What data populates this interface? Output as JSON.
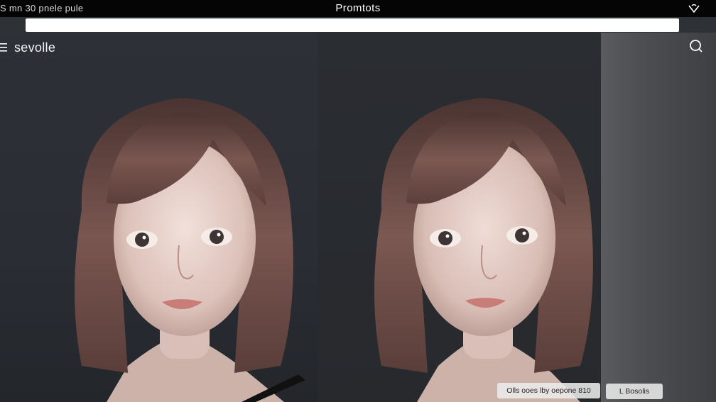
{
  "status_bar": {
    "left_text": "S mn 30 pnele pule",
    "title": "Promtots",
    "right_icon": "heart-wifi-icon"
  },
  "address_bar": {
    "value": "",
    "placeholder": ""
  },
  "header": {
    "menu_icon": "hamburger-menu-icon",
    "menu_label": "sevolle",
    "search_icon": "search-icon"
  },
  "overlays": {
    "caption": "Olls ooes lby oepone 810",
    "button_label": "L Bosolis"
  },
  "images": [
    {
      "name": "portrait-left",
      "description_icon": "portrait-image"
    },
    {
      "name": "portrait-middle",
      "description_icon": "portrait-image"
    }
  ],
  "colors": {
    "background": "#2e3136",
    "top_bar": "#050505",
    "hair": "#6b4a44",
    "skin": "#e8d5cf"
  }
}
